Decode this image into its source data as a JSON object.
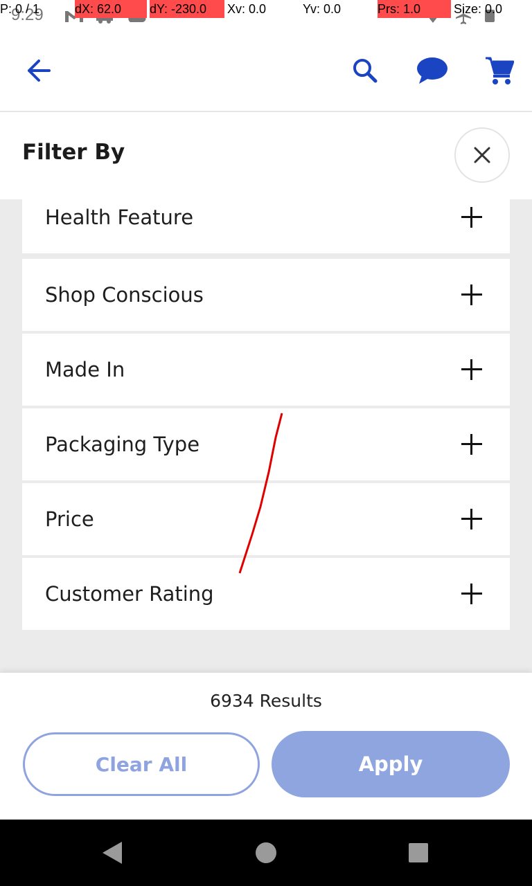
{
  "status_bar": {
    "time": "9:29",
    "icons": [
      "gmail-icon",
      "car-icon",
      "cloud-icon",
      "wifi-icon",
      "airplane-icon",
      "battery-icon"
    ]
  },
  "debug_overlay": {
    "p": "P: 0 / 1",
    "dx": "dX: 62.0",
    "dy": "dY: -230.0",
    "xv": "Xv: 0.0",
    "yv": "Yv: 0.0",
    "prs": "Prs: 1.0",
    "size": "Size: 0.0",
    "highlight_color": "#ff4b4b"
  },
  "appbar": {
    "icons": [
      "back-arrow-icon",
      "search-icon",
      "chat-icon",
      "cart-icon"
    ],
    "accent_color": "#1a44c2"
  },
  "filter_panel": {
    "title": "Filter By",
    "close_icon": "close-icon",
    "items": [
      {
        "label": "Health Feature"
      },
      {
        "label": "Shop Conscious"
      },
      {
        "label": "Made In"
      },
      {
        "label": "Packaging Type"
      },
      {
        "label": "Price"
      },
      {
        "label": "Customer Rating"
      }
    ]
  },
  "footer": {
    "results": "6934 Results",
    "clear_label": "Clear All",
    "apply_label": "Apply",
    "button_color": "#8fa5e0"
  },
  "nav_bar": {
    "icons": [
      "back-triangle-icon",
      "home-circle-icon",
      "recents-square-icon"
    ]
  }
}
